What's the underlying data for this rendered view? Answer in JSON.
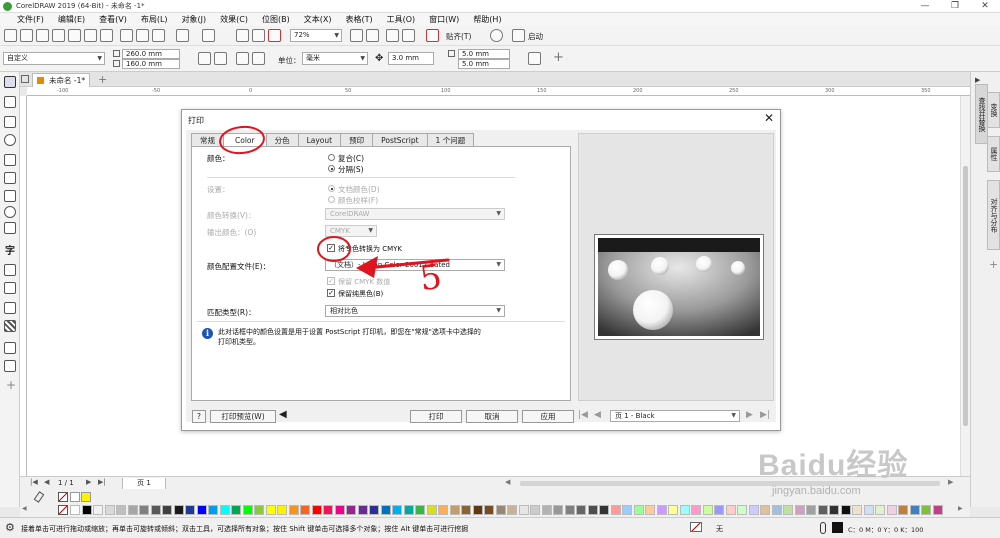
{
  "window": {
    "title": "CorelDRAW 2019 (64-Bit) - 未命名 -1*",
    "minimize": "—",
    "maximize": "❐",
    "close": "✕"
  },
  "menu": [
    "文件(F)",
    "编辑(E)",
    "查看(V)",
    "布局(L)",
    "对象(J)",
    "效果(C)",
    "位图(B)",
    "文本(X)",
    "表格(T)",
    "工具(O)",
    "窗口(W)",
    "帮助(H)"
  ],
  "toolbar": {
    "zoom": "72%",
    "snap_label": "贴齐(T)",
    "launch_label": "启动"
  },
  "property_bar": {
    "page_preset": "自定义",
    "width": "260.0 mm",
    "height": "160.0 mm",
    "unit_label": "单位：",
    "unit_value": "毫米",
    "nudge": "3.0 mm",
    "dup_x": "5.0 mm",
    "dup_y": "5.0 mm"
  },
  "document_tab": "未命名 -1*",
  "ruler_ticks": [
    "-100",
    "-50",
    "0",
    "50",
    "100",
    "150",
    "200",
    "250",
    "300",
    "350"
  ],
  "right_dock": {
    "tabs": [
      "查找并替换",
      "变换",
      "属性",
      "对齐与分布"
    ]
  },
  "page_bar": {
    "page_info": "1 / 1",
    "page_tab": "页 1"
  },
  "palette_colors": [
    "#ffffff",
    "#000000",
    "#f2f2f2",
    "#d9d9d9",
    "#bfbfbf",
    "#a6a6a6",
    "#808080",
    "#595959",
    "#404040",
    "#1a1a1a",
    "#1f3a93",
    "#0000ff",
    "#00a0e9",
    "#00ffff",
    "#00a651",
    "#00ff00",
    "#8dc63f",
    "#ffff00",
    "#fff200",
    "#f7941d",
    "#f26522",
    "#ff0000",
    "#ed145b",
    "#ec008c",
    "#92278f",
    "#662d91",
    "#2e3192",
    "#0072bc",
    "#00aeef",
    "#00a99d",
    "#39b54a",
    "#d7df23",
    "#fbaf5d",
    "#c69c6d",
    "#8c6239",
    "#603913",
    "#754c24",
    "#998675",
    "#c7b299",
    "#e6e6e6",
    "#cccccc",
    "#b3b3b3",
    "#999999",
    "#7f7f7f",
    "#666666",
    "#4d4d4d",
    "#333333",
    "#ff9999",
    "#99ccff",
    "#99ff99",
    "#ffcc99",
    "#cc99ff",
    "#ffff99",
    "#99ffff",
    "#ff99cc",
    "#ccff99",
    "#9999ff",
    "#ffcccc",
    "#ccffcc",
    "#ccccff",
    "#e0c0a0",
    "#a0c0e0",
    "#c0e0a0",
    "#d0a0c0",
    "#a0a0a0",
    "#606060",
    "#303030",
    "#101010",
    "#f0e0d0",
    "#d0e0f0",
    "#e0f0d0",
    "#f0d0e0",
    "#c08040",
    "#4080c0",
    "#80c040",
    "#c04080"
  ],
  "status_bar": {
    "hint": "接着单击可进行拖动或缩放；再单击可旋转或倾斜；双击工具，可选择所有对象；按住 Shift 键单击可选择多个对象；按住 Alt 键单击可进行挖掘",
    "fill_none": "无",
    "color_readout": "C：0 M：0 Y：0 K：100"
  },
  "dialog": {
    "title": "打印",
    "close": "✕",
    "tabs": [
      "常规",
      "Color",
      "分色",
      "Layout",
      "预印",
      "PostScript",
      "1 个问题"
    ],
    "active_tab": "Color",
    "color_label": "颜色：",
    "composite": "复合(C)",
    "separations": "分隔(S)",
    "settings_label": "设置：",
    "doc_color": "文档颜色(D)",
    "proof_color": "颜色校样(F)",
    "conversion_label": "颜色转换(V)：",
    "conversion_value": "CorelDRAW",
    "output_color_label": "输出颜色：(O)",
    "output_color_value": "CMYK",
    "convert_spot": "将专色转换为 CMYK",
    "profile_label": "颜色配置文件(E)：",
    "profile_value": "（文档）- Japan Color 2001 Coated",
    "preserve_cmyk": "保留 CMYK 数值",
    "preserve_black": "保留纯黑色(B)",
    "intent_label": "匹配类型(R)：",
    "intent_value": "相对比色",
    "info_text_1": "此对话框中的颜色设置是用于设置 PostScript 打印机，即您在\"常规\"选项卡中选择的",
    "info_text_2": "打印机类型。",
    "help_btn": "?",
    "preview_btn": "打印预览(W)",
    "print_btn": "打印",
    "cancel_btn": "取消",
    "apply_btn": "应用",
    "page_select": "页 1 - Black"
  },
  "annotations": {
    "handwritten_number": "5"
  },
  "watermark": {
    "main": "Baidu经验",
    "sub": "jingyan.baidu.com"
  },
  "accent_colors": {
    "annotation_red": "#e0141e",
    "info_blue": "#1c55b4"
  }
}
